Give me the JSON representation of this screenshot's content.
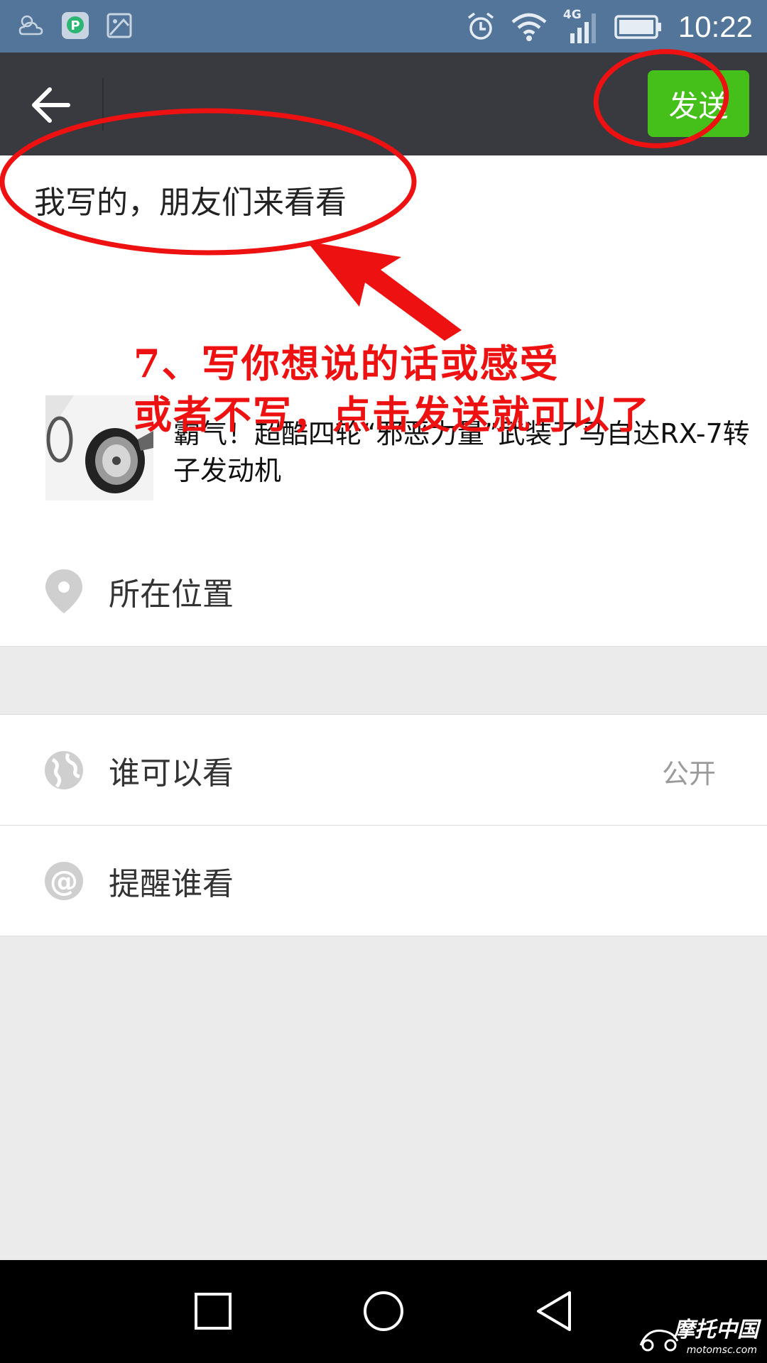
{
  "status_bar": {
    "network": "4G",
    "time": "10:22"
  },
  "header": {
    "send_label": "发送"
  },
  "compose": {
    "text": "我写的，朋友们来看看"
  },
  "shared_link": {
    "title": "霸气！超酷四轮“邪恶力量”武装了马自达RX-7转子发动机"
  },
  "location": {
    "label": "所在位置"
  },
  "visibility": {
    "label": "谁可以看",
    "value": "公开"
  },
  "mention": {
    "label": "提醒谁看"
  },
  "annotation": {
    "line1": "7、写你想说的话或感受",
    "line2": "或者不写，点击发送就可以了"
  },
  "watermark": {
    "name": "摩托中国",
    "url": "motomsc.com"
  },
  "colors": {
    "status_bar": "#527599",
    "title_bar": "#393a3f",
    "send_button": "#45c01a",
    "annotation": "#ee1111"
  }
}
